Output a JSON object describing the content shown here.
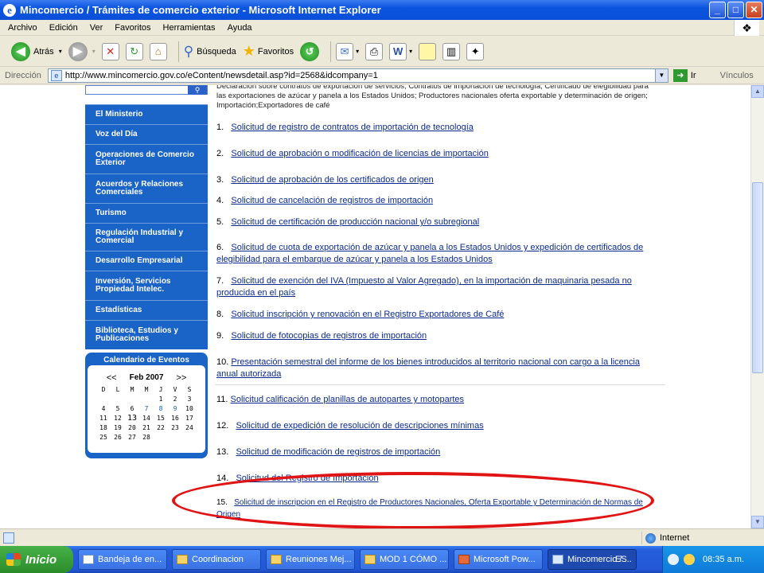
{
  "window": {
    "title": "Mincomercio / Trámites de comercio exterior - Microsoft Internet Explorer",
    "buttons": {
      "minimize": "_",
      "maximize": "□",
      "close": "✕"
    }
  },
  "menu": [
    "Archivo",
    "Edición",
    "Ver",
    "Favoritos",
    "Herramientas",
    "Ayuda"
  ],
  "toolbar": {
    "back": "Atrás",
    "search": "Búsqueda",
    "favorites": "Favoritos"
  },
  "address": {
    "label": "Dirección",
    "url": "http://www.mincomercio.gov.co/eContent/newsdetail.asp?id=2568&idcompany=1",
    "go": "Ir",
    "links": "Vínculos"
  },
  "nav": {
    "items": [
      "El Ministerio",
      "Voz del Día",
      "Operaciones de Comercio Exterior",
      "Acuerdos y Relaciones Comerciales",
      "Turismo",
      "Regulación Industrial y Comercial",
      "Desarrollo Empresarial",
      "Inversión, Servicios Propiedad Intelec.",
      "Estadísticas",
      "Biblioteca, Estudios y Publicaciones"
    ],
    "calendar": {
      "title": "Calendario de Eventos",
      "prev": "<<",
      "month": "Feb 2007",
      "next": ">>",
      "weekdays": [
        "D",
        "L",
        "M",
        "M",
        "J",
        "V",
        "S"
      ],
      "weeks": [
        [
          "",
          "",
          "",
          "",
          "1",
          "2",
          "3"
        ],
        [
          "4",
          "5",
          "6",
          "7",
          "8",
          "9",
          "10"
        ],
        [
          "11",
          "12",
          "13",
          "14",
          "15",
          "16",
          "17"
        ],
        [
          "18",
          "19",
          "20",
          "21",
          "22",
          "23",
          "24"
        ],
        [
          "25",
          "26",
          "27",
          "28",
          "",
          "",
          ""
        ]
      ]
    }
  },
  "content": {
    "intro": "Declaración sobre contratos de exportación de servicios; Contratos de importación de tecnología; Certificado de elegibilidad para las exportaciones de azúcar y panela a los Estados Unidos; Productores nacionales oferta exportable y determinación de origen; Importación;Exportadores de café",
    "items": [
      {
        "num": "1.",
        "text": "Solicitud de registro de contratos de importación de tecnología"
      },
      {
        "num": "2.",
        "text": "Solicitud de aprobación o modificación de licencias de importación"
      },
      {
        "num": "3.",
        "text": "Solicitud de aprobación de los certificados de origen"
      },
      {
        "num": "4.",
        "text": "Solicitud de cancelación de registros de importación"
      },
      {
        "num": "5.",
        "text": "Solicitud de certificación de producción nacional y/o subregional"
      },
      {
        "num": "6.",
        "text": "Solicitud de cuota de exportación de azúcar y panela a los Estados Unidos y expedición de certificados de elegibilidad para el  embarque de azúcar y panela a los Estados Unidos"
      },
      {
        "num": "7.",
        "text": "Solicitud de exención del IVA (Impuesto al Valor Agregado), en la importación de maquinaria pesada no producida en el país"
      },
      {
        "num": "8.",
        "text": "Solicitud inscripción y renovación en el Registro Exportadores de Café"
      },
      {
        "num": "9.",
        "text": "Solicitud de fotocopias de registros de importación"
      },
      {
        "num": "10.",
        "text": "Presentación semestral del informe de los bienes introducidos al territorio nacional con cargo a la licencia anual autorizada"
      },
      {
        "num": "11.",
        "text": "Solicitud calificación de planillas de autopartes y motopartes"
      },
      {
        "num": "12.",
        "text": "Solicitud de expedición de resolución de descripciones mínimas"
      },
      {
        "num": "13.",
        "text": "Solicitud de modificación de registros de importación"
      },
      {
        "num": "14.",
        "text": "Solicitud del Registro de Importación"
      },
      {
        "num": "15.",
        "text": "Solicitud de inscripcion en el Registro de Productores Nacionales, Oferta Exportable y Determinación de Normas de Origen"
      }
    ]
  },
  "status": {
    "zone": "Internet"
  },
  "taskbar": {
    "start": "Inicio",
    "tasks": [
      "Bandeja de en...",
      "Coordinacion",
      "Reuniones Mej...",
      "MOD 1 CÓMO ...",
      "Microsoft Pow...",
      "Mincomercio / ..."
    ],
    "lang": "ES",
    "clock": "08:35 a.m."
  },
  "colors": {
    "nav_bg": "#1a63c7",
    "link": "#0b2a8f",
    "highlight_oval": "#e01414",
    "titlebar": "#0a55e0"
  }
}
